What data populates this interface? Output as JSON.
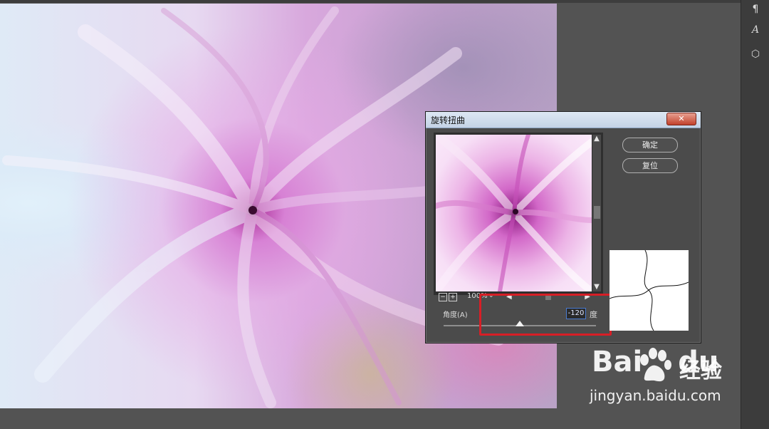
{
  "right_panel": {
    "buttons": [
      {
        "icon": "paragraph-icon",
        "glyph": "¶"
      },
      {
        "icon": "character-style-icon",
        "glyph": "A"
      },
      {
        "icon": "3d-cube-icon",
        "glyph": "⬡"
      }
    ]
  },
  "dialog": {
    "title": "旋转扭曲",
    "close_glyph": "✕",
    "ok_label": "确定",
    "reset_label": "复位",
    "zoom_out_glyph": "−",
    "zoom_in_glyph": "+",
    "zoom_value": "100%",
    "angle_label": "角度(A)",
    "angle_value": "-120",
    "angle_unit": "度",
    "angle_slider_fraction": 0.5
  },
  "watermark": {
    "logo_text": "Bai",
    "logo_suffix": "du",
    "brand_cn": "经验",
    "url": "jingyan.baidu.com"
  },
  "colors": {
    "highlight": "#d71e26",
    "accent_input_border": "#4a7bd1"
  }
}
